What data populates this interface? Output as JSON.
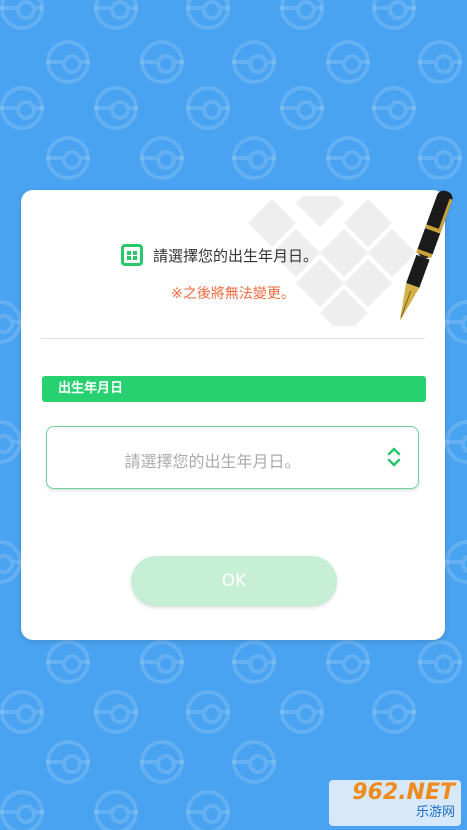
{
  "dialog": {
    "title": "請選擇您的出生年月日。",
    "warning": "※之後將無法變更。",
    "section_label": "出生年月日",
    "select_placeholder": "請選擇您的出生年月日。",
    "ok_label": "OK"
  },
  "watermark": {
    "main": "962.NET",
    "sub": "乐游网"
  },
  "colors": {
    "background": "#4aa3f0",
    "accent_green": "#28d170",
    "warning_orange": "#f26a3f",
    "ok_disabled": "#c6efd6"
  },
  "icons": [
    "calendar-icon",
    "chevron-updown-icon",
    "fountain-pen-icon",
    "pokeball-pattern"
  ]
}
